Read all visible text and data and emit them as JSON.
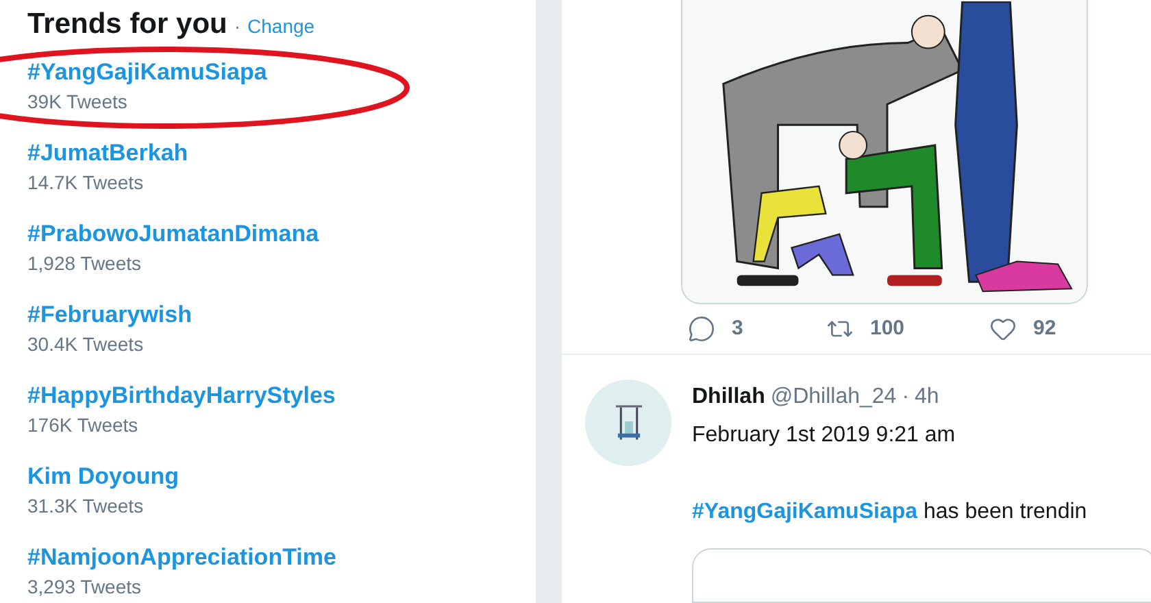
{
  "trends": {
    "title": "Trends for you",
    "separator": "·",
    "change_link": "Change",
    "items": [
      {
        "name": "#YangGajiKamuSiapa",
        "count": "39K Tweets",
        "circled": true
      },
      {
        "name": "#JumatBerkah",
        "count": "14.7K Tweets",
        "circled": false
      },
      {
        "name": "#PrabowoJumatanDimana",
        "count": "1,928 Tweets",
        "circled": false
      },
      {
        "name": "#Februarywish",
        "count": "30.4K Tweets",
        "circled": false
      },
      {
        "name": "#HappyBirthdayHarryStyles",
        "count": "176K Tweets",
        "circled": false
      },
      {
        "name": "Kim Doyoung",
        "count": "31.3K Tweets",
        "circled": false
      },
      {
        "name": "#NamjoonAppreciationTime",
        "count": "3,293 Tweets",
        "circled": false
      }
    ]
  },
  "tweet_actions": [
    {
      "kind": "reply",
      "count": "3"
    },
    {
      "kind": "retweet",
      "count": "100"
    },
    {
      "kind": "like",
      "count": "92"
    }
  ],
  "tweet": {
    "name": "Dhillah",
    "handle": "@Dhillah_24",
    "separator": "·",
    "time": "4h",
    "date_line": "February 1st 2019 9:21 am",
    "hashtag": "#YangGajiKamuSiapa",
    "text": "has been trendin"
  }
}
